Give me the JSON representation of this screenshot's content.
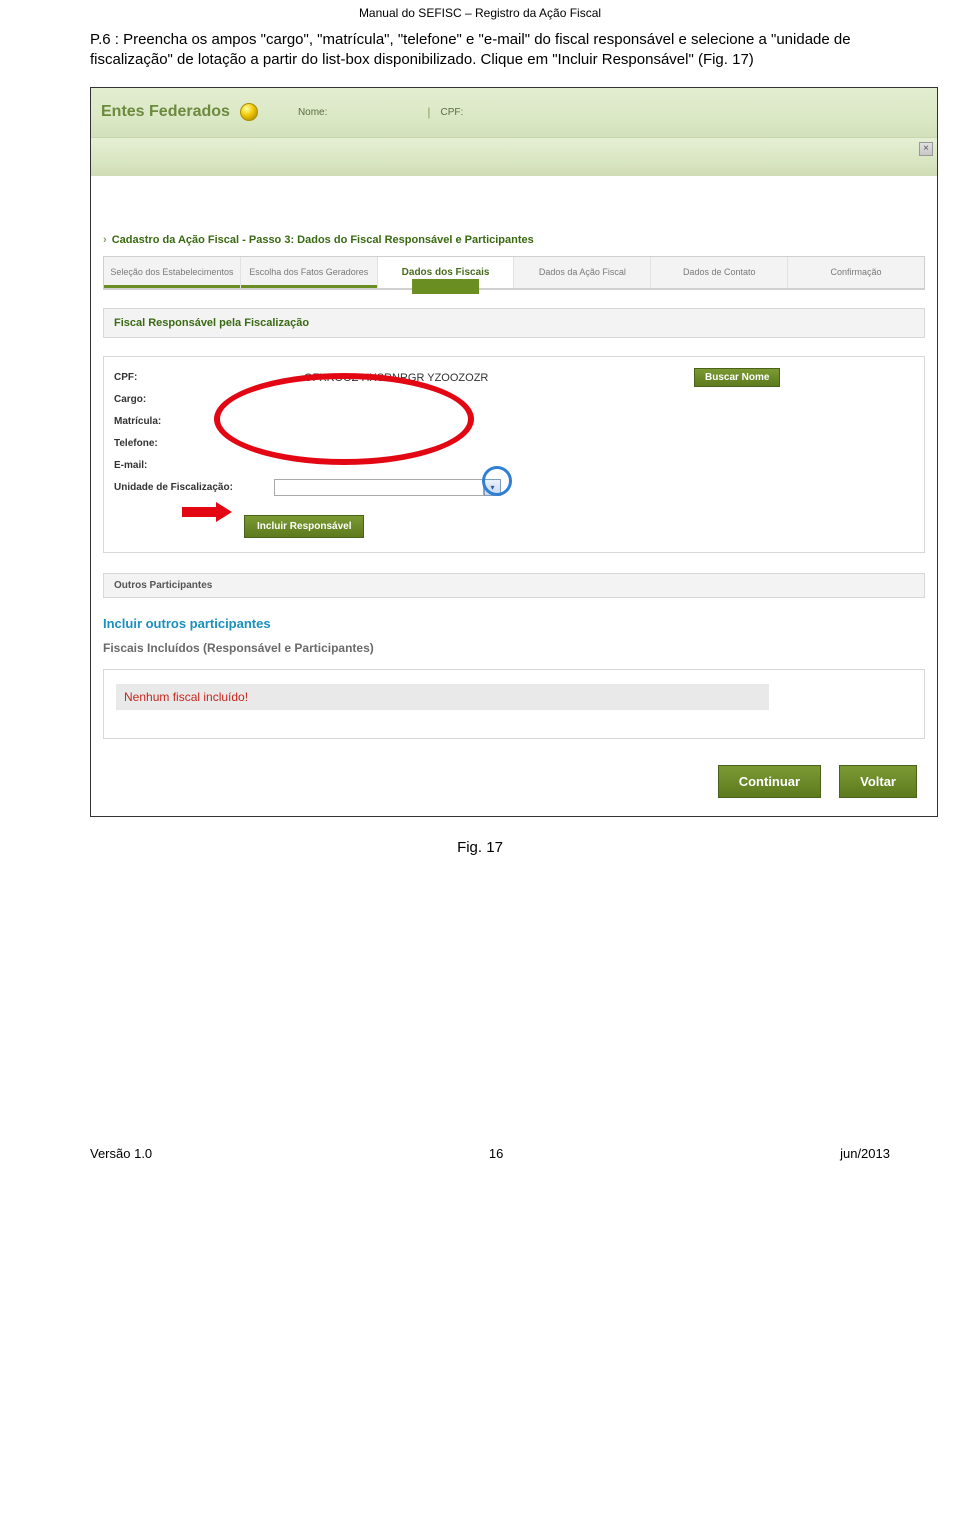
{
  "doc": {
    "header": "Manual do SEFISC – Registro da Ação Fiscal",
    "para": "P.6 : Preencha os ampos \"cargo\", \"matrícula\", \"telefone\" e \"e-mail\" do fiscal responsável e selecione a \"unidade de fiscalização\" de lotação a partir do list-box disponibilizado. Clique em \"Incluir Responsável\" (Fig. 17)",
    "figcap": "Fig. 17",
    "footer": {
      "left": "Versão 1.0",
      "center": "16",
      "right": "jun/2013"
    }
  },
  "topbar": {
    "brand": "Entes Federados",
    "nome_label": "Nome:",
    "cpf_label": "CPF:"
  },
  "breadcrumb": "Cadastro da Ação Fiscal - Passo 3: Dados do Fiscal Responsável e Participantes",
  "wizard": {
    "steps": [
      "Seleção dos Estabelecimentos",
      "Escolha dos Fatos Geradores",
      "Dados dos Fiscais",
      "Dados da Ação Fiscal",
      "Dados de Contato",
      "Confirmação"
    ]
  },
  "section": {
    "title": "Fiscal Responsável pela Fiscalização"
  },
  "form": {
    "cpf": {
      "label": "CPF:",
      "value": "OFXROOZ HXSRNRGR YZOOZOZR"
    },
    "cargo": {
      "label": "Cargo:"
    },
    "matricula": {
      "label": "Matrícula:"
    },
    "telefone": {
      "label": "Telefone:"
    },
    "email": {
      "label": "E-mail:"
    },
    "unidade": {
      "label": "Unidade de Fiscalização:"
    },
    "btn_buscar": "Buscar Nome",
    "btn_incluir": "Incluir Responsável"
  },
  "outros": {
    "bar": "Outros Participantes",
    "link": "Incluir outros participantes",
    "subtitle": "Fiscais Incluídos (Responsável e Participantes)",
    "empty": "Nenhum fiscal incluído!"
  },
  "footer_btns": {
    "continuar": "Continuar",
    "voltar": "Voltar"
  }
}
